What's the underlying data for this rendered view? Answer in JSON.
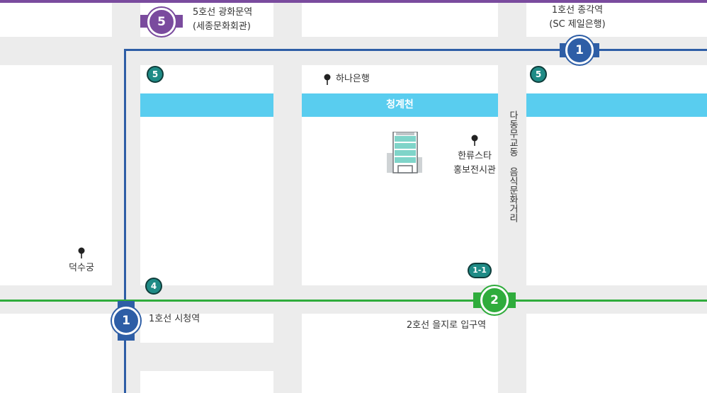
{
  "stations": {
    "gwanghwamun": {
      "number": "5",
      "line1": "5호선 광화문역",
      "line2": "(세종문화회관)"
    },
    "jonggak": {
      "number": "1",
      "line1": "1호선 종각역",
      "line2": "(SC 제일은행)"
    },
    "cityhall": {
      "number": "1",
      "label": "1호선 시청역"
    },
    "euljiro": {
      "number": "2",
      "label": "2호선 을지로 입구역"
    }
  },
  "exits": {
    "exit_5_left": "5",
    "exit_5_right": "5",
    "exit_4": "4",
    "exit_1_1": "1-1"
  },
  "places": {
    "hana_bank": "하나은행",
    "cheonggyecheon": "청계천",
    "hallyu_star_1": "한류스타",
    "hallyu_star_2": "홍보전시관",
    "deoksugung": "덕수궁",
    "food_street": "다동무교동 음식문화거리"
  },
  "colors": {
    "line1": "#2e5ea6",
    "line2": "#2fac3c",
    "line5": "#7a4b9e",
    "exit": "#1f8b86",
    "stream": "#59cdef",
    "road": "#ececec"
  }
}
